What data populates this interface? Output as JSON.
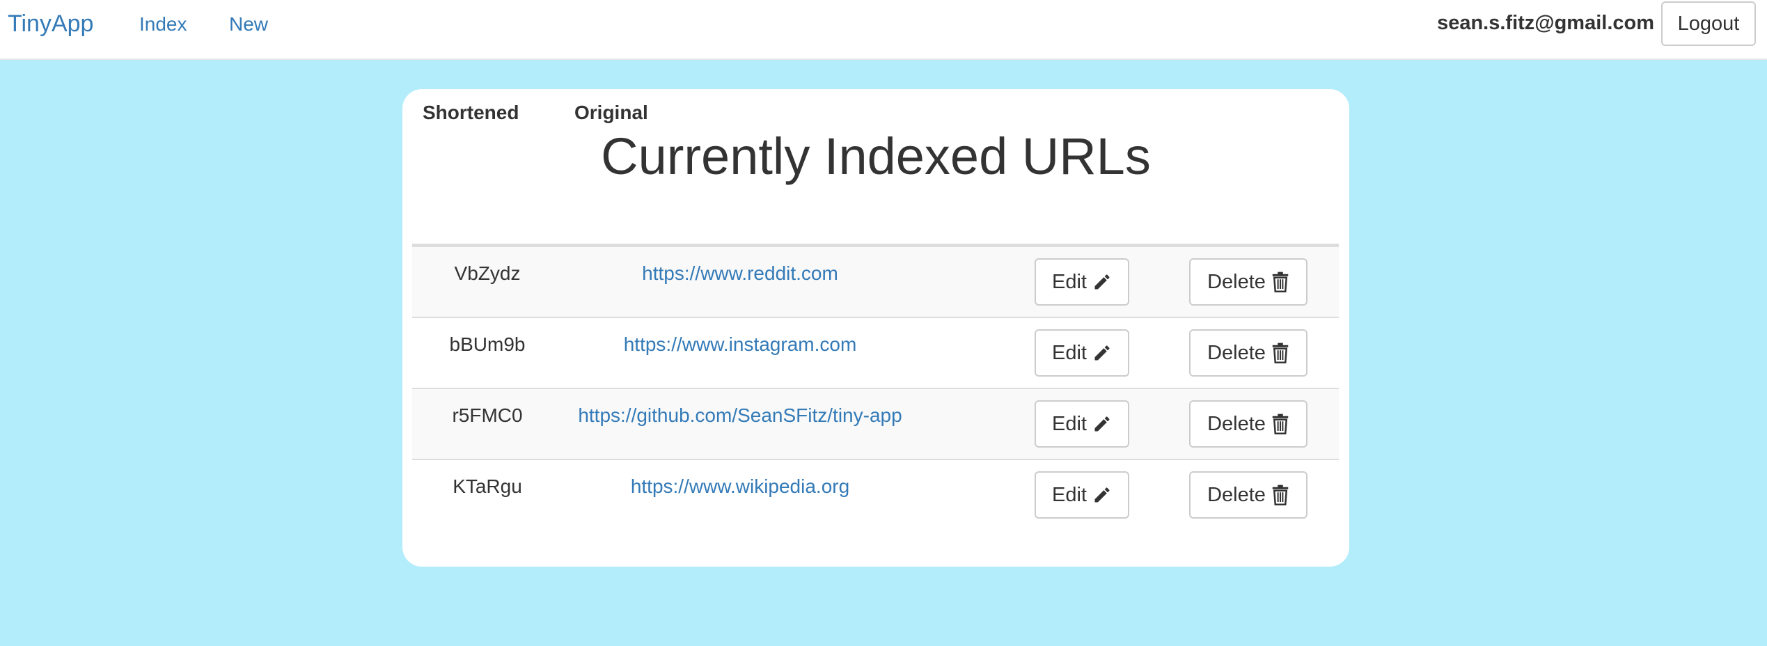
{
  "navbar": {
    "brand": "TinyApp",
    "links": [
      {
        "label": "Index"
      },
      {
        "label": "New"
      }
    ],
    "user_email": "sean.s.fitz@gmail.com",
    "logout_label": "Logout"
  },
  "main": {
    "title": "Currently Indexed URLs",
    "columns": [
      "Shortened",
      "Original"
    ],
    "edit_label": "Edit",
    "delete_label": "Delete",
    "rows": [
      {
        "short": "VbZydz",
        "original": "https://www.reddit.com"
      },
      {
        "short": "bBUm9b",
        "original": "https://www.instagram.com"
      },
      {
        "short": "r5FMC0",
        "original": "https://github.com/SeanSFitz/tiny-app"
      },
      {
        "short": "KTaRgu",
        "original": "https://www.wikipedia.org"
      }
    ]
  },
  "icons": {
    "edit": "pencil-icon",
    "delete": "trash-icon"
  },
  "colors": {
    "background": "#b3ecfb",
    "link": "#337ab7",
    "text": "#333333",
    "stripe": "#f9f9f9"
  }
}
